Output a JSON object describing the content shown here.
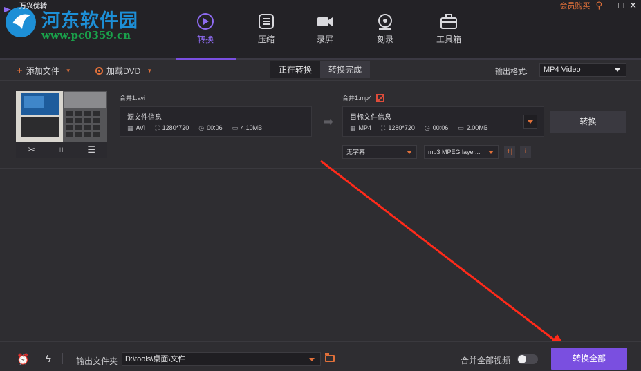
{
  "app": {
    "name": "万兴优转",
    "watermark_title": "河东软件园",
    "watermark_url": "www.pc0359.cn"
  },
  "window_controls": {
    "member": "会员购买",
    "search_icon": "search-icon",
    "minimize": "–",
    "maximize": "□",
    "close": "✕"
  },
  "nav": [
    {
      "label": "转换",
      "icon": "convert-icon",
      "active": true
    },
    {
      "label": "压缩",
      "icon": "compress-icon",
      "active": false
    },
    {
      "label": "录屏",
      "icon": "record-icon",
      "active": false
    },
    {
      "label": "刻录",
      "icon": "burn-disc-icon",
      "active": false
    },
    {
      "label": "工具箱",
      "icon": "toolbox-icon",
      "active": false
    }
  ],
  "toolbar": {
    "add_file": "添加文件",
    "load_dvd": "加载DVD",
    "tab_converting": "正在转换",
    "tab_done": "转换完成",
    "output_format_label": "输出格式:",
    "output_format_value": "MP4 Video"
  },
  "file": {
    "source_name": "合并1.avi",
    "source_info_title": "源文件信息",
    "source": {
      "format": "AVI",
      "resolution": "1280*720",
      "duration": "00:06",
      "size": "4.10MB"
    },
    "target_name": "合并1.mp4",
    "target_info_title": "目标文件信息",
    "target": {
      "format": "MP4",
      "resolution": "1280*720",
      "duration": "00:06",
      "size": "2.00MB"
    },
    "convert_button": "转换",
    "subtitle_value": "无字幕",
    "audio_value": "mp3 MPEG layer..."
  },
  "bottom": {
    "output_folder_label": "输出文件夹",
    "output_path": "D:\\tools\\桌面\\文件",
    "merge_label": "合并全部视频",
    "merge_on": false,
    "convert_all": "转换全部"
  },
  "colors": {
    "accent": "#7a4fe0",
    "orange": "#e0703a",
    "annotation": "#ff2a1a"
  }
}
